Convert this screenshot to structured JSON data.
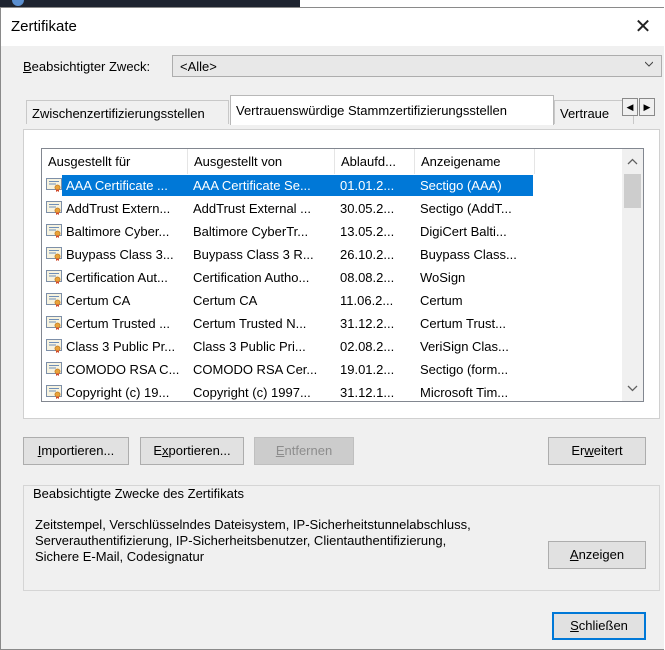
{
  "dialog": {
    "title": "Zertifikate"
  },
  "purpose": {
    "label_u": "B",
    "label_rest": "eabsichtigter Zweck:",
    "value": "<Alle>"
  },
  "tabs": [
    {
      "label": "Zwischenzertifizierungsstellen"
    },
    {
      "label": "Vertrauenswürdige Stammzertifizierungsstellen"
    },
    {
      "label": "Vertraue"
    }
  ],
  "list": {
    "columns": [
      "Ausgestellt für",
      "Ausgestellt von",
      "Ablaufd...",
      "Anzeigename"
    ],
    "rows": [
      {
        "for": "AAA Certificate ...",
        "by": "AAA Certificate Se...",
        "expires": "01.01.2...",
        "name": "Sectigo (AAA)"
      },
      {
        "for": "AddTrust Extern...",
        "by": "AddTrust External ...",
        "expires": "30.05.2...",
        "name": "Sectigo (AddT..."
      },
      {
        "for": "Baltimore Cyber...",
        "by": "Baltimore CyberTr...",
        "expires": "13.05.2...",
        "name": "DigiCert Balti..."
      },
      {
        "for": "Buypass Class 3...",
        "by": "Buypass Class 3 R...",
        "expires": "26.10.2...",
        "name": "Buypass Class..."
      },
      {
        "for": "Certification Aut...",
        "by": "Certification Autho...",
        "expires": "08.08.2...",
        "name": "WoSign"
      },
      {
        "for": "Certum CA",
        "by": "Certum CA",
        "expires": "11.06.2...",
        "name": "Certum"
      },
      {
        "for": "Certum Trusted ...",
        "by": "Certum Trusted N...",
        "expires": "31.12.2...",
        "name": "Certum Trust..."
      },
      {
        "for": "Class 3 Public Pr...",
        "by": "Class 3 Public Pri...",
        "expires": "02.08.2...",
        "name": "VeriSign Clas..."
      },
      {
        "for": "COMODO RSA C...",
        "by": "COMODO RSA Cer...",
        "expires": "19.01.2...",
        "name": "Sectigo (form..."
      },
      {
        "for": "Copyright (c) 19...",
        "by": "Copyright (c) 1997...",
        "expires": "31.12.1...",
        "name": "Microsoft Tim..."
      }
    ]
  },
  "buttons": {
    "import": {
      "u": "I",
      "rest": "mportieren..."
    },
    "export": {
      "pre": "E",
      "u": "x",
      "rest": "portieren..."
    },
    "remove": {
      "u": "E",
      "rest": "ntfernen"
    },
    "advanced": {
      "pre": "Er",
      "u": "w",
      "rest": "eitert"
    },
    "view": {
      "u": "A",
      "rest": "nzeigen"
    },
    "close": {
      "u": "S",
      "rest": "chließen"
    }
  },
  "purposes_group": {
    "title": "Beabsichtigte Zwecke des Zertifikats",
    "lines": [
      "Zeitstempel, Verschlüsselndes Dateisystem, IP-Sicherheitstunnelabschluss,",
      "Serverauthentifizierung, IP-Sicherheitsbenutzer, Clientauthentifizierung,",
      "Sichere E-Mail, Codesignatur"
    ]
  }
}
